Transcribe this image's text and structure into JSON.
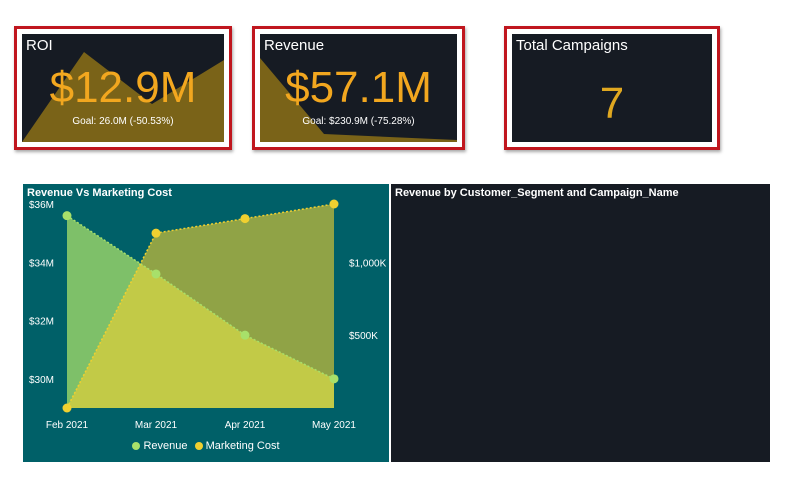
{
  "kpis": {
    "roi": {
      "title": "ROI",
      "value": "$12.9M",
      "flag": "!",
      "goal": "Goal: 26.0M (-50.53%)"
    },
    "revenue": {
      "title": "Revenue",
      "value": "$57.1M",
      "flag": "!",
      "goal": "Goal: $230.9M (-75.28%)"
    },
    "campaigns": {
      "title": "Total Campaigns",
      "value": "7"
    }
  },
  "colors": {
    "card_border": "#c0161e",
    "card_bg": "#161b23",
    "kpi_value": "#f2a71f",
    "sparkline_fill": "#7a6318",
    "chart_bg": "#006068",
    "revenue_series": "#a8e06a",
    "marketing_series": "#f0d030"
  },
  "chart_data": {
    "type": "area",
    "title": "Revenue Vs Marketing Cost",
    "categories": [
      "Feb 2021",
      "Mar 2021",
      "Apr 2021",
      "May 2021"
    ],
    "y_left_ticks": [
      "$36M",
      "$34M",
      "$32M",
      "$30M"
    ],
    "y_right_ticks": [
      "$1,000K",
      "$500K"
    ],
    "y_left_range": [
      29,
      36
    ],
    "y_right_range": [
      0,
      1400
    ],
    "series": [
      {
        "name": "Revenue",
        "axis": "left",
        "values": [
          35.6,
          33.6,
          31.5,
          30.0
        ]
      },
      {
        "name": "Marketing Cost",
        "axis": "right",
        "values": [
          0,
          1200,
          1300,
          1400
        ]
      }
    ],
    "legend_position": "bottom"
  },
  "segment_panel": {
    "title": "Revenue by Customer_Segment and Campaign_Name"
  }
}
